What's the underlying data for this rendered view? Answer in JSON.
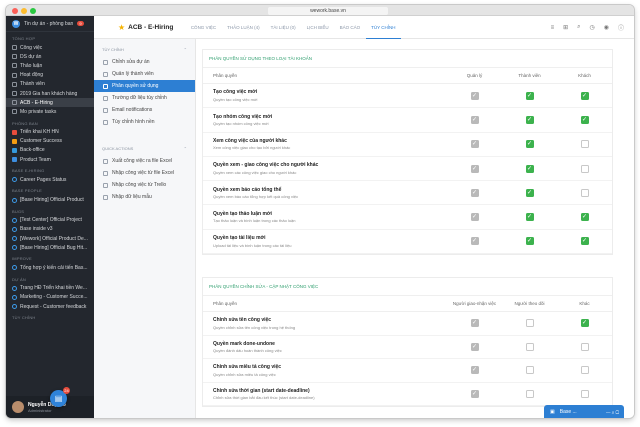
{
  "browser": {
    "url": "wework.base.vn"
  },
  "colors": {
    "accent": "#2d7fd3",
    "check_green": "#3cb24d",
    "section_title": "#2f9e6e"
  },
  "sidebar": {
    "workspace": "Tin dự án - phòng ban",
    "workspace_badge": "9",
    "sections": [
      {
        "title": "TỔNG HỢP",
        "items": [
          {
            "label": "Công việc",
            "icon": "tasks-icon"
          },
          {
            "label": "DS dự án",
            "icon": "list-icon"
          },
          {
            "label": "Thảo luận",
            "icon": "chat-icon"
          },
          {
            "label": "Hoạt động",
            "icon": "activity-icon"
          },
          {
            "label": "Thành viên",
            "icon": "members-icon"
          },
          {
            "label": "2019 Gia han khách hàng",
            "icon": "project-icon"
          },
          {
            "label": "ACB - E-Hiring",
            "icon": "project-icon",
            "active": true
          },
          {
            "label": "Mo private tasks",
            "icon": "project-icon"
          }
        ]
      },
      {
        "title": "PHÒNG BAN",
        "items": [
          {
            "label": "Triển khai KH HN",
            "icon": "dept-icon",
            "color": "#e74c3c"
          },
          {
            "label": "Customer Success",
            "icon": "dept-icon",
            "color": "#f39c12"
          },
          {
            "label": "Back-office",
            "icon": "dept-icon",
            "color": "#3498db"
          },
          {
            "label": "Product Team",
            "icon": "dept-icon",
            "color": "#3d8ee0"
          }
        ]
      },
      {
        "title": "BASE E-HIRING",
        "items": [
          {
            "label": "Career Pages Status",
            "icon": "circle-icon"
          }
        ]
      },
      {
        "title": "BASE PEOPLE",
        "items": [
          {
            "label": "[Base Hiring] Official Product",
            "icon": "circle-icon"
          }
        ]
      },
      {
        "title": "BUGS",
        "items": [
          {
            "label": "[Test Center] Official Project",
            "icon": "circle-icon"
          },
          {
            "label": "Base inside v3",
            "icon": "circle-icon"
          },
          {
            "label": "[Wework] Official Product De...",
            "icon": "circle-icon"
          },
          {
            "label": "[Base Hiring] Official Bug Hit...",
            "icon": "circle-icon"
          }
        ]
      },
      {
        "title": "IMPROVE",
        "items": [
          {
            "label": "Tổng hợp ý kiến cải tiến Bas...",
            "icon": "circle-icon"
          }
        ]
      },
      {
        "title": "DỰ ÁN",
        "items": [
          {
            "label": "Trang HĐ Triển khai tiền We...",
            "icon": "circle-icon"
          },
          {
            "label": "Marketing - Customer Succe...",
            "icon": "circle-icon"
          },
          {
            "label": "Request - Customer feedback",
            "icon": "circle-icon"
          }
        ]
      },
      {
        "title": "TÙY CHỈNH",
        "items": []
      }
    ],
    "user_name": "Nguyễn Duy Mo",
    "user_sub": "Administrator",
    "fab_badge": "24"
  },
  "header": {
    "title": "ACB - E-Hiring",
    "tabs": [
      "CÔNG VIỆC",
      "THẢO LUẬN (4)",
      "TÀI LIỆU (0)",
      "LỊCH BIỂU",
      "BÁO CÁO",
      "TÙY CHỈNH"
    ],
    "active_tab": 5
  },
  "menu": {
    "section1": "TÙY CHỈNH",
    "items1": [
      {
        "label": "Chỉnh sửa dự án",
        "icon": "edit-icon"
      },
      {
        "label": "Quản lý thành viên",
        "icon": "user-icon"
      },
      {
        "label": "Phân quyền sử dụng",
        "icon": "permission-icon",
        "active": true
      },
      {
        "label": "Trường dữ liệu tùy chỉnh",
        "icon": "field-icon"
      },
      {
        "label": "Email notifications",
        "icon": "email-icon"
      },
      {
        "label": "Tùy chỉnh hình nền",
        "icon": "image-icon"
      }
    ],
    "section2": "QUICK ACTIONS",
    "items2": [
      {
        "label": "Xuất công việc ra file Excel",
        "icon": "export-icon"
      },
      {
        "label": "Nhập công việc từ file Excel",
        "icon": "import-icon"
      },
      {
        "label": "Nhập công việc từ Trello",
        "icon": "trello-icon"
      },
      {
        "label": "Nhập dữ liệu mẫu",
        "icon": "sample-icon"
      }
    ]
  },
  "card1": {
    "title": "PHÂN QUYỀN SỬ DỤNG THEO LOẠI TÀI KHOẢN",
    "columns": [
      "Phân quyền",
      "Quản lý",
      "Thành viên",
      "Khách"
    ],
    "rows": [
      {
        "title": "Tạo công việc mới",
        "desc": "Quyền tạo công việc mới",
        "checks": [
          "d",
          "g",
          "g"
        ]
      },
      {
        "title": "Tạo nhóm công việc mới",
        "desc": "Quyền tạo nhóm công việc mới",
        "checks": [
          "d",
          "g",
          "g"
        ]
      },
      {
        "title": "Xem công việc của người khác",
        "desc": "Xem công việc giao cho tạo bởi người khác",
        "checks": [
          "d",
          "g",
          "e"
        ]
      },
      {
        "title": "Quyền xem - giao công việc cho người khác",
        "desc": "Quyền xem các công việc giao cho người khác",
        "checks": [
          "d",
          "g",
          "e"
        ]
      },
      {
        "title": "Quyền xem báo cáo tổng thể",
        "desc": "Quyền xem báo cáo tổng hợp kết quả công việc",
        "checks": [
          "d",
          "g",
          "e"
        ]
      },
      {
        "title": "Quyền tạo thảo luận mới",
        "desc": "Tạo thảo luận và bình luận trong các thảo luận",
        "checks": [
          "d",
          "g",
          "g"
        ]
      },
      {
        "title": "Quyền tạo tài liệu mới",
        "desc": "Upload tài liệu và bình luận trong các tài liệu",
        "checks": [
          "d",
          "g",
          "g"
        ]
      }
    ]
  },
  "card2": {
    "title": "PHÂN QUYỀN CHỈNH SỬA - CẬP NHẬT CÔNG VIỆC",
    "columns": [
      "Phân quyền",
      "Người giao-nhận việc",
      "Người theo dõi",
      "Khác"
    ],
    "rows": [
      {
        "title": "Chỉnh sửa tên công việc",
        "desc": "Quyền chỉnh sửa tên công việc trong hệ thống",
        "checks": [
          "d",
          "e",
          "g"
        ]
      },
      {
        "title": "Quyền mark done-undone",
        "desc": "Quyền đánh dấu hoàn thành công việc",
        "checks": [
          "d",
          "e",
          "e"
        ]
      },
      {
        "title": "Chỉnh sửa miêu tả công việc",
        "desc": "Quyền chỉnh sửa miêu tả công việc",
        "checks": [
          "d",
          "e",
          "e"
        ]
      },
      {
        "title": "Chỉnh sửa thời gian (start date-deadline)",
        "desc": "Chỉnh sửa thời gian bắt đầu kết thúc (start date-deadline)",
        "checks": [
          "d",
          "e",
          "e"
        ]
      }
    ]
  },
  "chat": {
    "label": "Base ..."
  }
}
